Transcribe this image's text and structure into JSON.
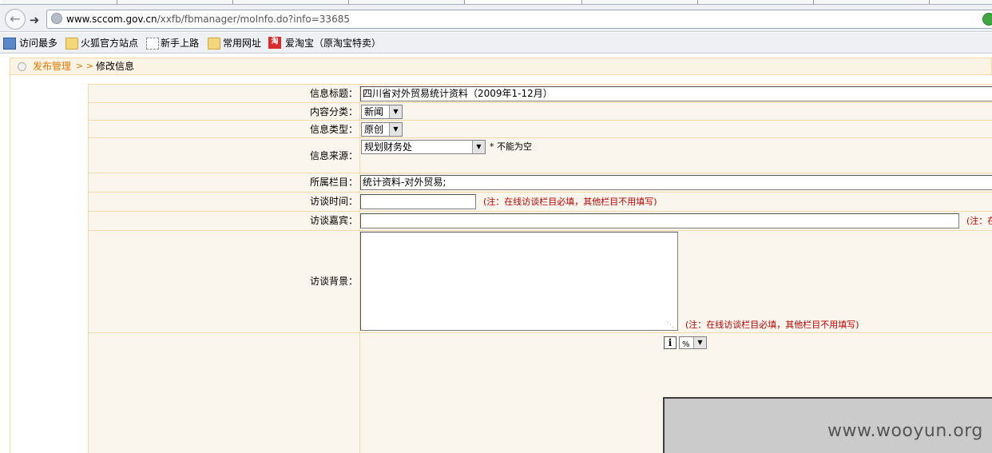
{
  "browser": {
    "url_domain": "www.sccom.gov.cn",
    "url_path": "/xxfb/fbmanager/moInfo.do?info=33685",
    "tab_fragment": "....",
    "bookmarks": [
      {
        "label": "访问最多",
        "icon": "most-visited-icon"
      },
      {
        "label": "火狐官方站点",
        "icon": "folder-icon"
      },
      {
        "label": "新手上路",
        "icon": "page-icon"
      },
      {
        "label": "常用网址",
        "icon": "folder-icon"
      },
      {
        "label": "爱淘宝（原淘宝特卖）",
        "icon": "taobao-icon",
        "icon_text": "淘"
      }
    ]
  },
  "breadcrumb": {
    "parent": "发布管理",
    "separator": "> >",
    "current": "修改信息"
  },
  "form": {
    "title_label": "信息标题：",
    "title_value": "四川省对外贸易统计资料（2009年1-12月）",
    "category_label": "内容分类：",
    "category_value": "新闻",
    "type_label": "信息类型：",
    "type_value": "原创",
    "source_label": "信息来源：",
    "source_value": "规划财务处",
    "source_note": "* 不能为空",
    "column_label": "所属栏目：",
    "column_value": "统计资料-对外贸易;",
    "time_label": "访谈时间：",
    "time_value": "",
    "time_note": "(注：在线访谈栏目必填，其他栏目不用填写)",
    "guest_label": "访谈嘉宾：",
    "guest_value": "",
    "guest_note": "(注：在",
    "background_label": "访谈背景：",
    "background_note": "(注：在线访谈栏目必填，其他栏目不用填写)",
    "editor_info_label": "i",
    "editor_zoom": "%"
  },
  "watermark": "www.wooyun.org",
  "colors": {
    "breadcrumb_link": "#e07a00",
    "note_red": "#c00000",
    "panel_bg": "#fbf6ed",
    "panel_border": "#f3d9a8"
  }
}
